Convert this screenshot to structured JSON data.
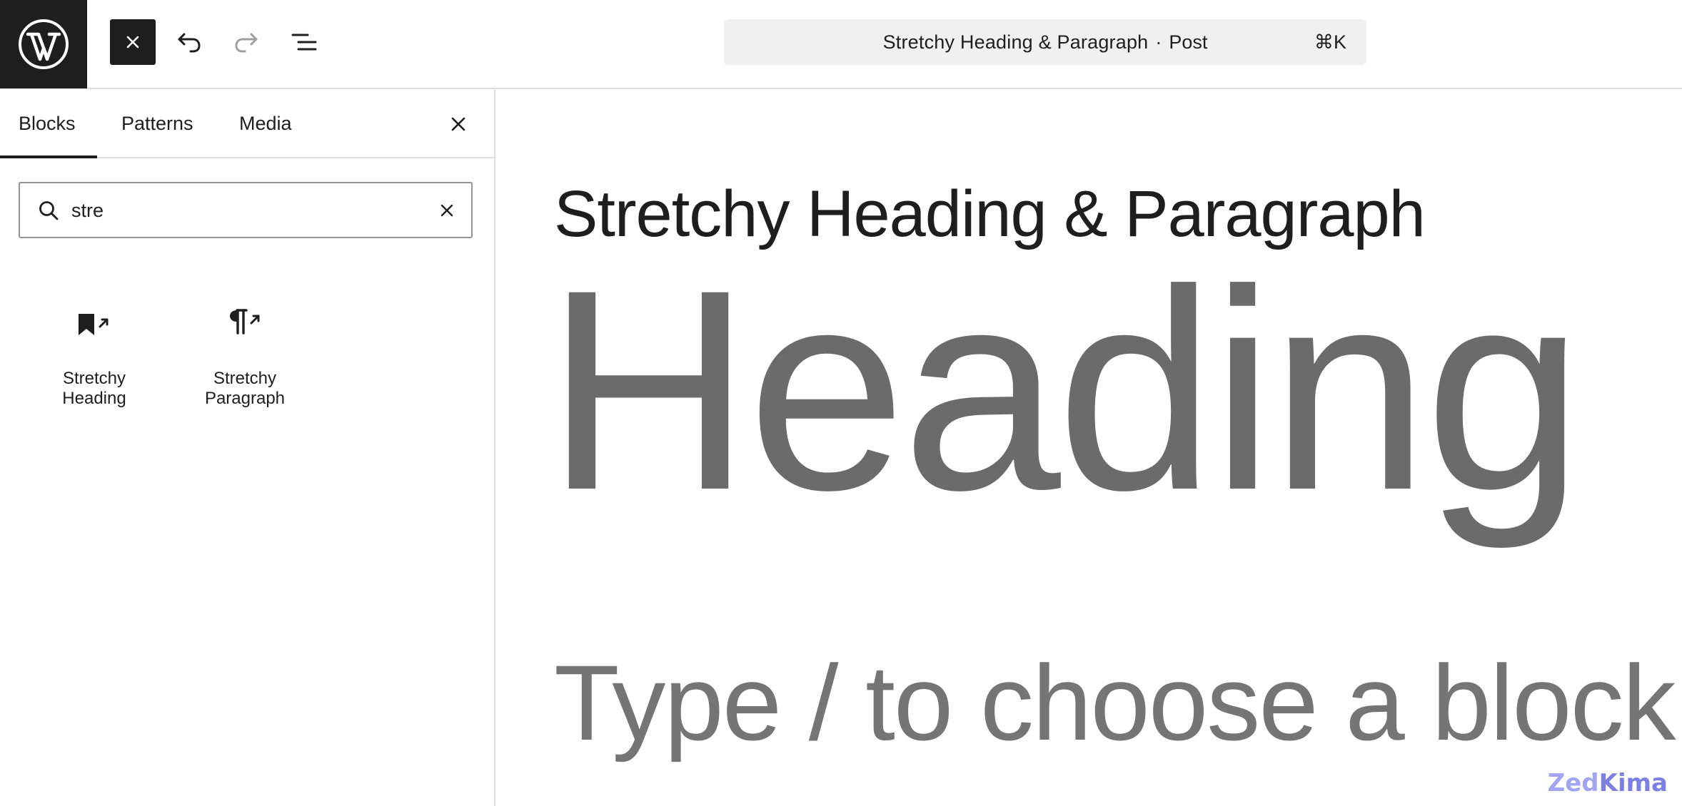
{
  "topbar": {
    "logo_icon": "wordpress-logo-icon",
    "close_icon": "close-icon",
    "undo_icon": "undo-icon",
    "redo_icon": "redo-icon",
    "document_overview_icon": "list-view-icon",
    "command_bar": {
      "title": "Stretchy Heading & Paragraph",
      "separator": "·",
      "post_type": "Post",
      "shortcut": "⌘K"
    }
  },
  "sidebar": {
    "tabs": [
      {
        "label": "Blocks",
        "active": true
      },
      {
        "label": "Patterns",
        "active": false
      },
      {
        "label": "Media",
        "active": false
      }
    ],
    "close_icon": "close-icon",
    "search": {
      "value": "stre",
      "placeholder": "Search",
      "search_icon": "search-icon",
      "clear_icon": "close-icon"
    },
    "results": [
      {
        "line1": "Stretchy",
        "line2": "Heading",
        "icon": "stretchy-heading-icon"
      },
      {
        "line1": "Stretchy",
        "line2": "Paragraph",
        "icon": "stretchy-paragraph-icon"
      }
    ]
  },
  "canvas": {
    "post_title": "Stretchy Heading & Paragraph",
    "heading": "Heading",
    "placeholder": "Type / to choose a block"
  },
  "watermark": {
    "part1": "Zed",
    "part2": "Kima"
  },
  "colors": {
    "dark": "#1e1e1e",
    "heading_gray": "#6b6b6b",
    "placeholder_gray": "#757575",
    "border": "#e0e0e0",
    "command_bar_bg": "#f0f0f0"
  }
}
